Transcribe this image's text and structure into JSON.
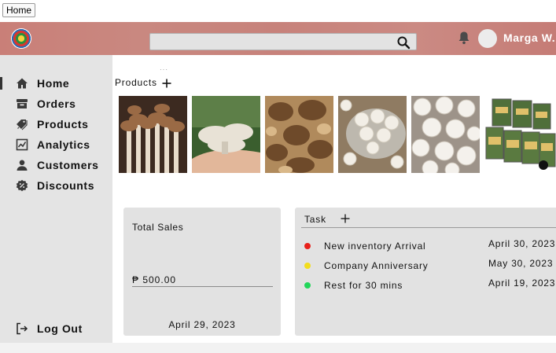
{
  "browser": {
    "tab_label": "Home"
  },
  "header": {
    "search": {
      "value": "",
      "placeholder": ""
    },
    "user": {
      "name": "Marga W."
    }
  },
  "sidebar": {
    "items": [
      {
        "label": "Home",
        "icon": "home-icon",
        "active": true
      },
      {
        "label": "Orders",
        "icon": "archive-box-icon",
        "active": false
      },
      {
        "label": "Products",
        "icon": "tags-icon",
        "active": false
      },
      {
        "label": "Analytics",
        "icon": "chart-icon",
        "active": false
      },
      {
        "label": "Customers",
        "icon": "person-icon",
        "active": false
      },
      {
        "label": "Discounts",
        "icon": "discount-badge-icon",
        "active": false
      }
    ],
    "logout_label": "Log Out"
  },
  "products": {
    "heading": "Products",
    "images": [
      "shimeji-mushrooms",
      "oyster-mushrooms",
      "shiitake-mushrooms",
      "button-mushrooms-bowl",
      "white-button-mushrooms",
      "mushroom-chips-packs"
    ]
  },
  "total_sales": {
    "title": "Total Sales",
    "amount": "₱ 500.00",
    "date": "April 29, 2023"
  },
  "tasks": {
    "title": "Task",
    "items": [
      {
        "name": "New inventory Arrival",
        "date": "April 30, 2023",
        "color": "#e8201a"
      },
      {
        "name": "Company Anniversary",
        "date": "May 30, 2023",
        "color": "#f2dd1c"
      },
      {
        "name": "Rest for 30 mins",
        "date": "April 19, 2023",
        "color": "#22d65a"
      }
    ]
  },
  "colors": {
    "header_bg": "#c98880",
    "sidebar_bg": "#e4e4e4",
    "card_bg": "#e2e2e2"
  }
}
